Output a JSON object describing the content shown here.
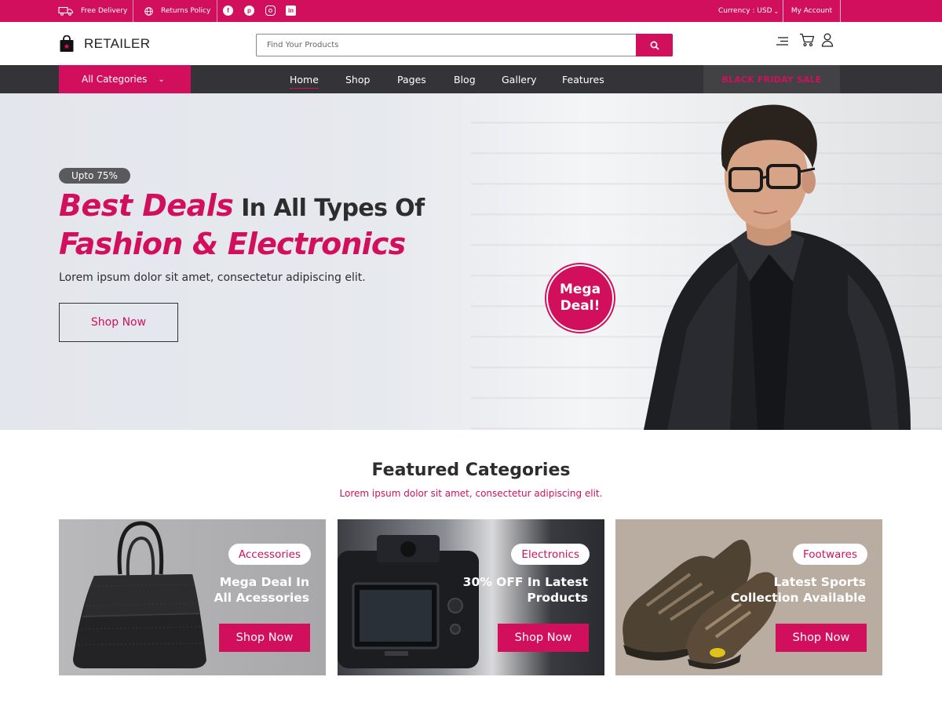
{
  "colors": {
    "brand": "#d20f5c",
    "nav_bg": "#343438",
    "topbar_bg": "#d20f5c"
  },
  "topbar": {
    "free_delivery": "Free Delivery",
    "returns_policy": "Returns Policy",
    "social_icons": [
      "facebook-icon",
      "pinterest-icon",
      "instagram-icon",
      "linkedin-icon"
    ],
    "currency": "Currency : USD",
    "my_account": "My Account"
  },
  "header": {
    "logo_text": "RETAILER",
    "search_placeholder": "Find Your Products",
    "icons": [
      "menu-icon",
      "cart-icon",
      "user-icon"
    ]
  },
  "nav": {
    "all_categories": "All Categories",
    "links": [
      "Home",
      "Shop",
      "Pages",
      "Blog",
      "Gallery",
      "Features"
    ],
    "active": "Home",
    "promo": "BLACK FRIDAY SALE"
  },
  "hero": {
    "badge": "Upto 75%",
    "title_pink_1": "Best Deals",
    "title_dark_1": " In All Types Of",
    "title_pink_2": "Fashion & Electronics",
    "subtitle": "Lorem ipsum dolor sit amet, consectetur adipiscing elit.",
    "button": "Shop Now",
    "mega_line1": "Mega",
    "mega_line2": "Deal!"
  },
  "featured": {
    "title": "Featured Categories",
    "subtitle": "Lorem ipsum dolor sit amet, consectetur adipiscing elit.",
    "cards": [
      {
        "tag": "Accessories",
        "line1": "Mega Deal In",
        "line2": "All Acessories",
        "button": "Shop Now"
      },
      {
        "tag": "Electronics",
        "line1": "30% OFF In Latest",
        "line2": "Products",
        "button": "Shop Now"
      },
      {
        "tag": "Footwares",
        "line1": "Latest Sports",
        "line2": "Collection Available",
        "button": "Shop Now"
      }
    ]
  }
}
